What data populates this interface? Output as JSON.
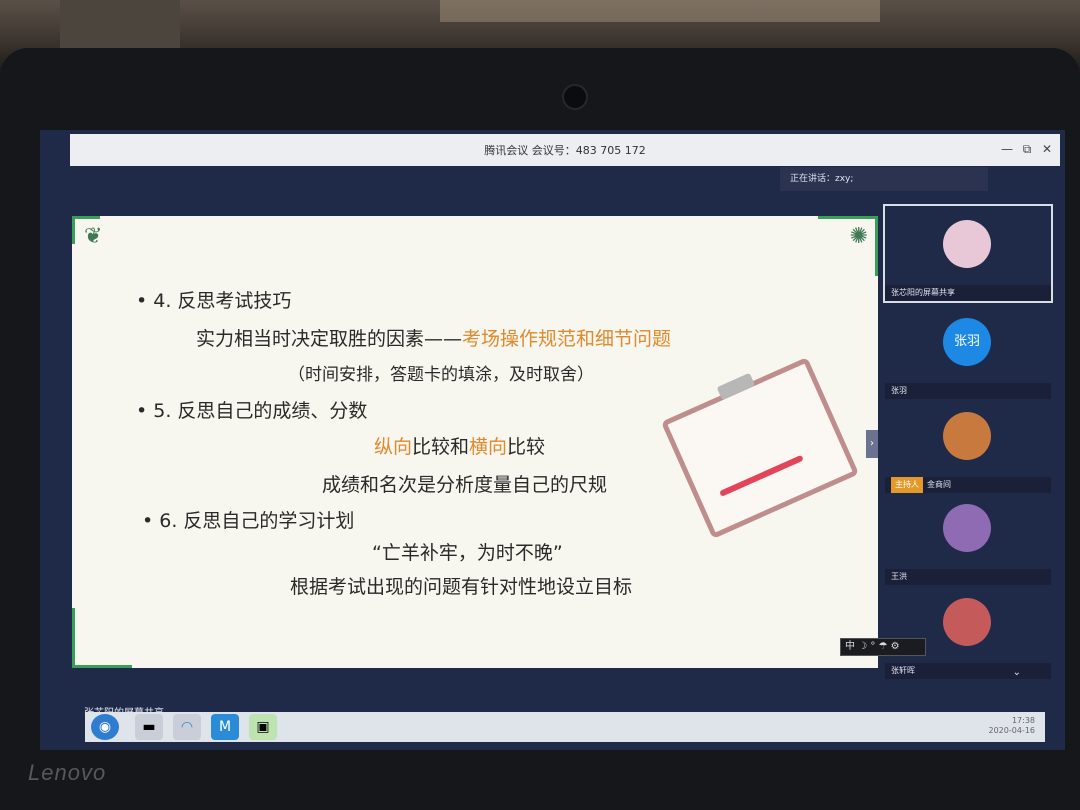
{
  "meeting": {
    "window_title": "腾讯会议 会议号：483 705 172",
    "speaking": "正在讲话：zxy;"
  },
  "slide": {
    "items": [
      {
        "text": "• 4. 反思考试技巧"
      },
      {
        "text": "实力相当时决定取胜的因素——",
        "accent": "考场操作规范和细节问题"
      },
      {
        "text": "（时间安排，答题卡的填涂，及时取舍）"
      },
      {
        "text": "• 5. 反思自己的成绩、分数"
      },
      {
        "text": "成绩和名次是分析度量自己的尺规"
      },
      {
        "text": "• 6. 反思自己的学习计划"
      },
      {
        "text": "“亡羊补牢，为时不晚”"
      },
      {
        "text": "根据考试出现的问题有针对性地设立目标"
      }
    ],
    "compare": {
      "a": "纵向",
      "b": "比较和",
      "c": "横向",
      "d": "比较"
    },
    "collapse_glyph": "›",
    "toolbar": "中 ☽ ° ☂ ⚙"
  },
  "participants": [
    {
      "name": "张芯阳的屏幕共享",
      "avatar_color": "#e8c8d6",
      "active": true
    },
    {
      "name": "张羽",
      "avatar_text": "张羽",
      "avatar_color": "#1e88e5"
    },
    {
      "name": "金商间",
      "host_label": "主持人",
      "avatar_color": "#c87a3e"
    },
    {
      "name": "王洪",
      "avatar_color": "#8f6bb3"
    },
    {
      "name": "张轩晖",
      "avatar_color": "#c55a5a"
    }
  ],
  "share_label": "张芯阳的屏幕共享",
  "window_buttons": {
    "minimize": "—",
    "restore": "⧉",
    "close": "✕"
  },
  "chevron": "⌄",
  "taskbar": {
    "start": "◉",
    "icons": [
      "▬",
      "◠",
      "M",
      "▣"
    ],
    "tray_time": "17:38",
    "tray_date": "2020-04-16"
  },
  "brand": "Lenovo"
}
